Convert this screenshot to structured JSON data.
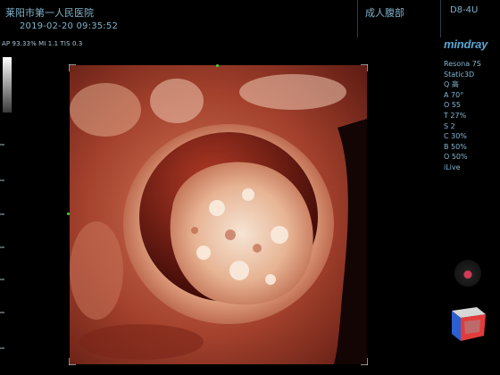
{
  "header": {
    "hospital": "莱阳市第一人民医院",
    "datetime": "2019-02-20   09:35:52",
    "preset": "成人腹部",
    "probe": "D8-4U"
  },
  "params_line": "AP 93.33%  MI 1.1  TIS 0.3",
  "brand": {
    "logo": "mindray",
    "accent": "#5aa6d0"
  },
  "panel": {
    "items": [
      "Resona 7S",
      "Static3D",
      "Q 高",
      "A 70°",
      "O 55",
      "T 27%",
      "S 2",
      "C 30%",
      "B 50%",
      "O 50%",
      "iLive"
    ]
  },
  "icons": {
    "orientation": "orientation-ball-icon",
    "cube": "3d-orientation-cube-icon"
  },
  "colors": {
    "marker": "#3cdc3c",
    "text": "#7fb3c9"
  }
}
